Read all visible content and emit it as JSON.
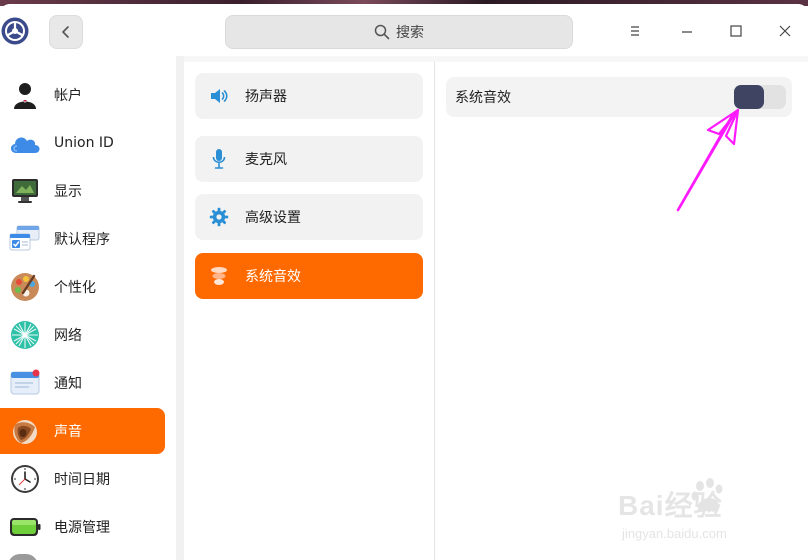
{
  "window": {
    "search_placeholder": "搜索"
  },
  "sidebar": {
    "items": [
      {
        "label": "帐户",
        "icon": "user-account-icon"
      },
      {
        "label": "Union ID",
        "icon": "cloud-icon"
      },
      {
        "label": "显示",
        "icon": "monitor-icon"
      },
      {
        "label": "默认程序",
        "icon": "default-apps-icon"
      },
      {
        "label": "个性化",
        "icon": "palette-icon"
      },
      {
        "label": "网络",
        "icon": "network-icon"
      },
      {
        "label": "通知",
        "icon": "notification-icon"
      },
      {
        "label": "声音",
        "icon": "sound-icon",
        "active": true
      },
      {
        "label": "时间日期",
        "icon": "clock-icon"
      },
      {
        "label": "电源管理",
        "icon": "battery-icon"
      }
    ]
  },
  "sound_menu": {
    "items": [
      {
        "label": "扬声器",
        "icon": "speaker-icon"
      },
      {
        "label": "麦克风",
        "icon": "microphone-icon"
      },
      {
        "label": "高级设置",
        "icon": "gear-icon"
      },
      {
        "label": "系统音效",
        "icon": "sound-effects-icon",
        "active": true
      }
    ]
  },
  "content": {
    "setting_label": "系统音效",
    "toggle_on": false
  },
  "watermark": {
    "brand": "Bai经验",
    "url": "jingyan.baidu.com"
  },
  "colors": {
    "accent": "#ff6a00",
    "toggle_knob": "#3f4463",
    "annotation": "#ff00ff"
  }
}
